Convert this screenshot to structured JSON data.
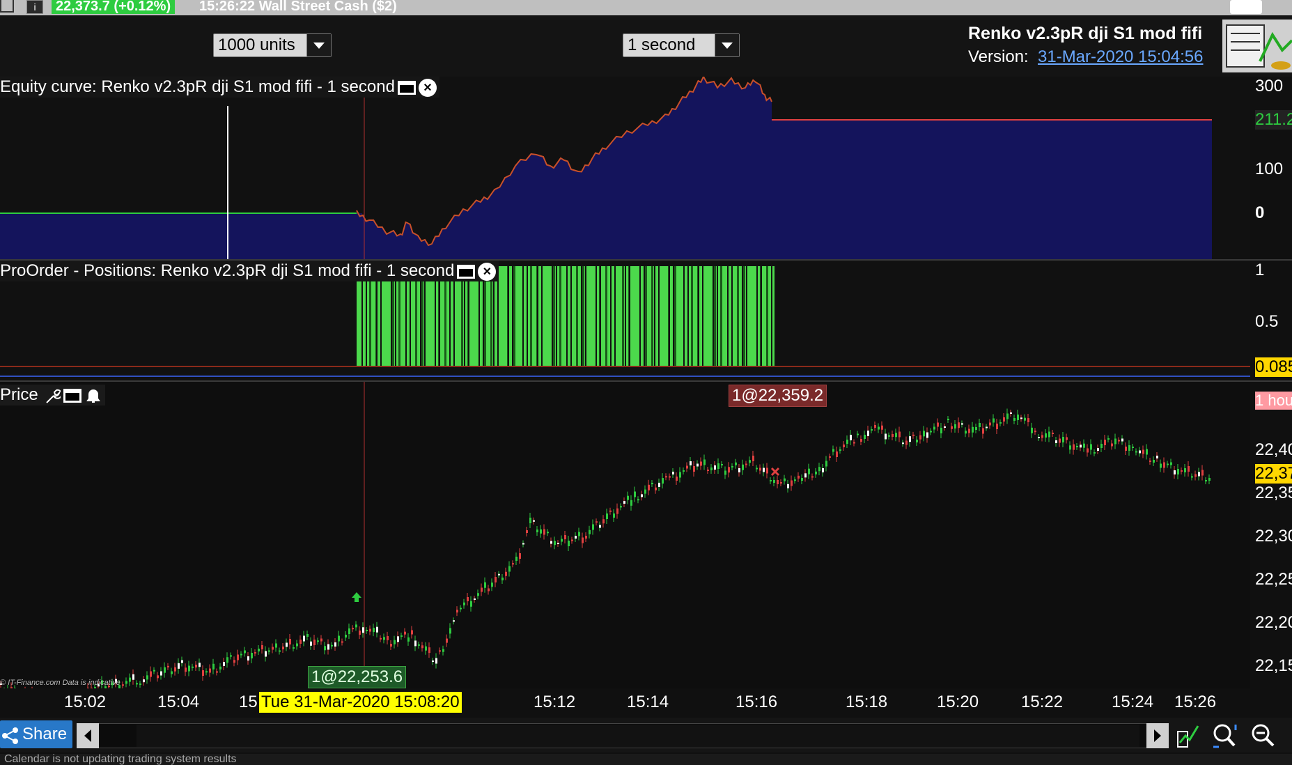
{
  "top_bar": {
    "quote": "22,373.7 (+0.12%)",
    "time_instrument": "15:26:22 Wall Street Cash ($2)",
    "info_label": "i"
  },
  "toolbar": {
    "units_select": "1000 units",
    "timeframe_select": "1 second"
  },
  "strategy": {
    "name": "Renko v2.3pR dji S1 mod fifi",
    "version_label": "Version:",
    "version_date": "31-Mar-2020 15:04:56"
  },
  "panels": {
    "equity_title": "Equity curve: Renko v2.3pR dji S1 mod fifi - 1 second",
    "positions_title": "ProOrder - Positions: Renko v2.3pR dji S1 mod fifi - 1 second",
    "price_title": "Price"
  },
  "equity_axis": [
    "300",
    "211.2",
    "100",
    "0"
  ],
  "positions_axis": [
    "1",
    "0.5",
    "0.085"
  ],
  "price_axis": [
    "1 hour",
    "22,40",
    "22,37",
    "22,35",
    "22,30",
    "22,25",
    "22,20",
    "22,15"
  ],
  "annotations": {
    "entry": "1@22,253.6",
    "exit": "1@22,359.2",
    "copyright": "© IT-Finance.com  Data is indicative"
  },
  "x_axis": {
    "labels": [
      "15:02",
      "15:04",
      "15",
      "15:12",
      "15:14",
      "15:16",
      "15:18",
      "15:20",
      "15:22",
      "15:24",
      "15:26"
    ],
    "cursor_label": "Tue 31-Mar-2020 15:08:20"
  },
  "bottom": {
    "share_label": "Share",
    "status_text": "Calendar is not updating trading system results"
  },
  "colors": {
    "equity_fill": "#14145c",
    "position_green": "#4cd94c",
    "up_candle": "#2ecc40",
    "down_candle": "#e04040",
    "cursor_date_bg": "#ffff00",
    "current_price_bg": "#ffd700"
  }
}
